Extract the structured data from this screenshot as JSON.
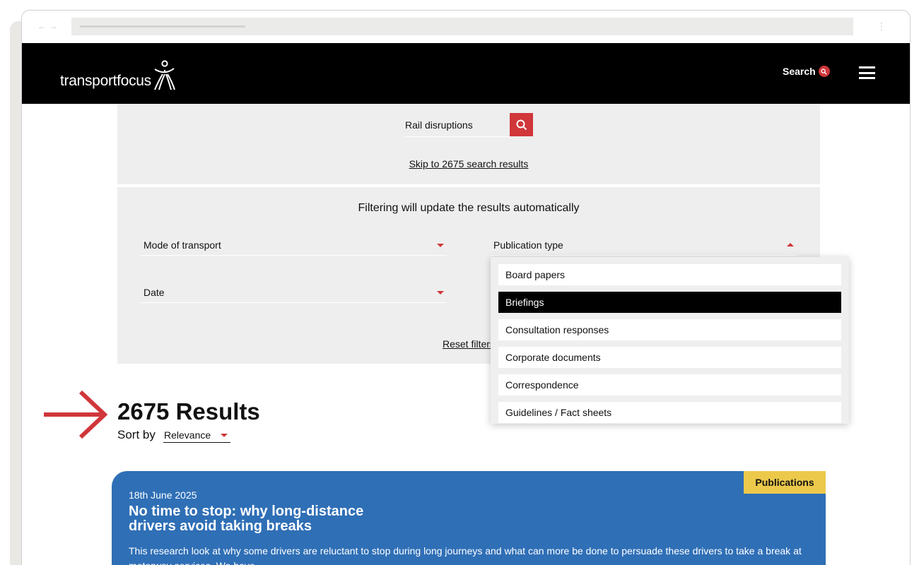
{
  "browser": {
    "back_icon": "arrow-left-icon",
    "forward_icon": "arrow-right-icon",
    "menu_icon": "kebab-menu-icon"
  },
  "header": {
    "logo_text": "transportfocus",
    "search_label": "Search",
    "colors": {
      "background": "#000000",
      "accent": "#d0363a"
    }
  },
  "search": {
    "query": "Rail disruptions",
    "skip_link": "Skip to 2675 search results"
  },
  "filters": {
    "note": "Filtering will update the results automatically",
    "mode_of_transport": "Mode of transport",
    "publication_type": "Publication type",
    "date": "Date",
    "reset": "Reset filters"
  },
  "dropdown": {
    "options": [
      "Board papers",
      "Briefings",
      "Consultation responses",
      "Corporate documents",
      "Correspondence",
      "Guidelines / Fact sheets"
    ],
    "highlighted": "Briefings"
  },
  "results": {
    "count_label": "2675 Results",
    "sort_label": "Sort by",
    "sort_value": "Relevance"
  },
  "card": {
    "badge": "Publications",
    "date": "18th June 2025",
    "title": "No time to stop: why long-distance drivers avoid taking breaks",
    "description": "This research look at why some drivers are reluctant to stop during long journeys and what can more be done to persuade these drivers to take a break at motorway services. We have",
    "colors": {
      "background": "#2f6fb6",
      "badge": "#ecc94b"
    }
  }
}
